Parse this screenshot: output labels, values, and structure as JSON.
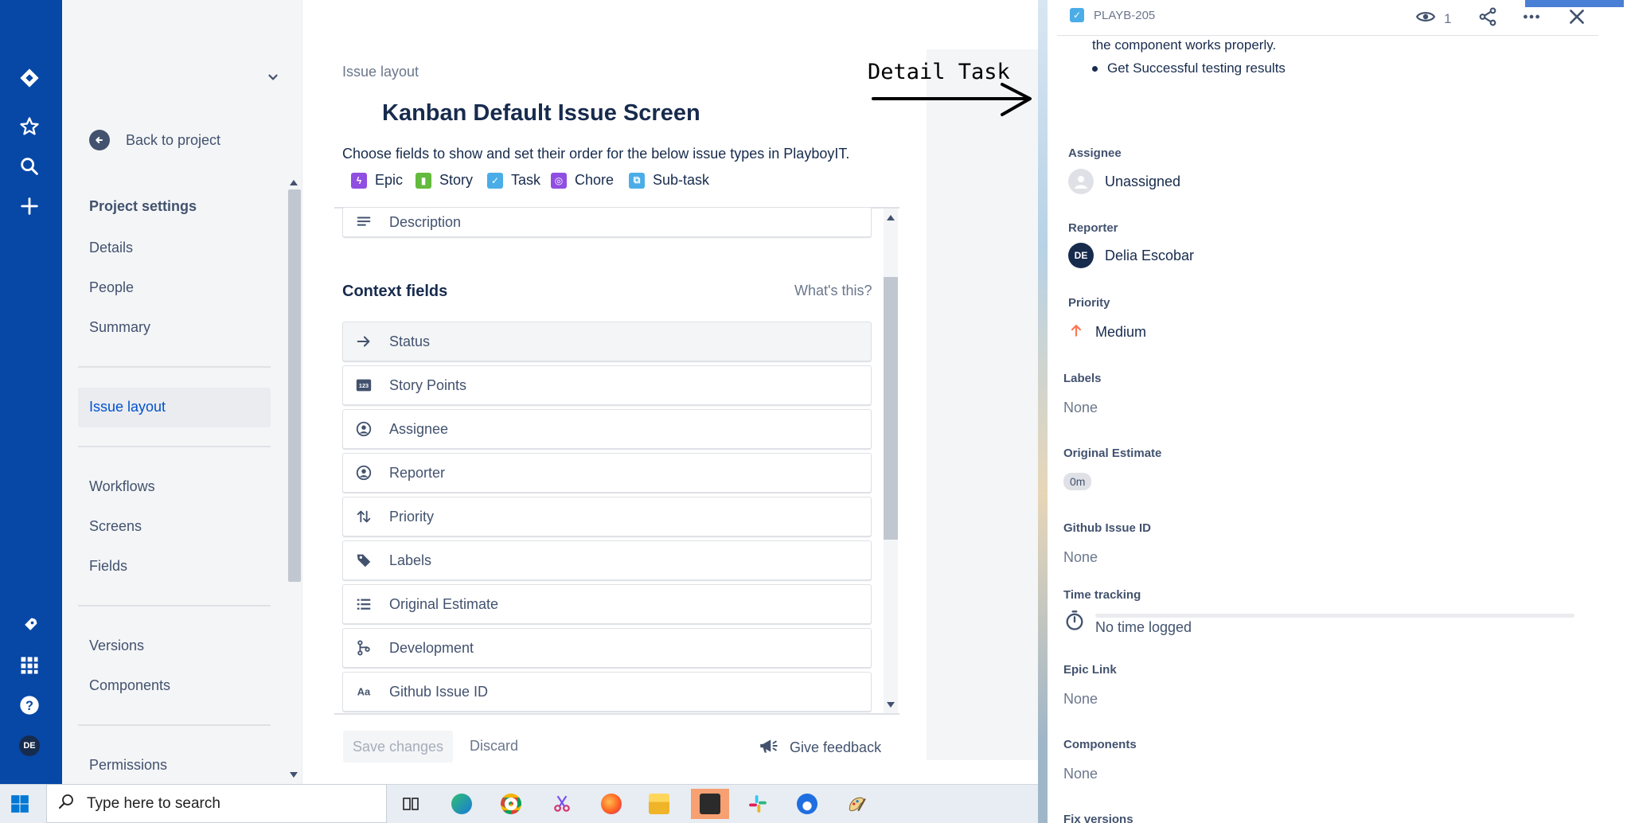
{
  "rail": {
    "avatar_initials": "DE"
  },
  "sidebar": {
    "back_label": "Back to project",
    "section_title": "Project settings",
    "items": [
      "Details",
      "People",
      "Summary",
      "Issue layout",
      "Workflows",
      "Screens",
      "Fields",
      "Versions",
      "Components",
      "Permissions"
    ]
  },
  "main": {
    "breadcrumb": "Issue layout",
    "title": "Kanban Default Issue Screen",
    "subtitle": "Choose fields to show and set their order for the below issue types in PlayboyIT.",
    "issue_types": [
      "Epic",
      "Story",
      "Task",
      "Chore",
      "Sub-task"
    ],
    "description_field": "Description",
    "context_title": "Context fields",
    "whats_this": "What's this?",
    "fields": [
      "Status",
      "Story Points",
      "Assignee",
      "Reporter",
      "Priority",
      "Labels",
      "Original Estimate",
      "Development",
      "Github Issue ID"
    ],
    "save_label": "Save changes",
    "discard_label": "Discard",
    "feedback_label": "Give feedback"
  },
  "annotation": {
    "text": "Detail Task"
  },
  "panel": {
    "issue_key": "PLAYB-205",
    "watchers": "1",
    "desc_tail": "the component works properly.",
    "bullet": "Get Successful testing results",
    "assignee_label": "Assignee",
    "assignee_value": "Unassigned",
    "reporter_label": "Reporter",
    "reporter_initials": "DE",
    "reporter_value": "Delia Escobar",
    "priority_label": "Priority",
    "priority_value": "Medium",
    "labels_label": "Labels",
    "labels_value": "None",
    "estimate_label": "Original Estimate",
    "estimate_value": "0m",
    "github_label": "Github Issue ID",
    "github_value": "None",
    "time_label": "Time tracking",
    "time_value": "No time logged",
    "epic_label": "Epic Link",
    "epic_value": "None",
    "components_label": "Components",
    "components_value": "None",
    "fixversions_label": "Fix versions"
  },
  "taskbar": {
    "search_placeholder": "Type here to search"
  },
  "colors": {
    "rail": "#0747a6",
    "epic": "#904ee2",
    "story": "#63ba3c",
    "task": "#4bade8",
    "chore": "#904ee2",
    "subtask": "#4bade8",
    "priority_medium": "#ff7452"
  }
}
